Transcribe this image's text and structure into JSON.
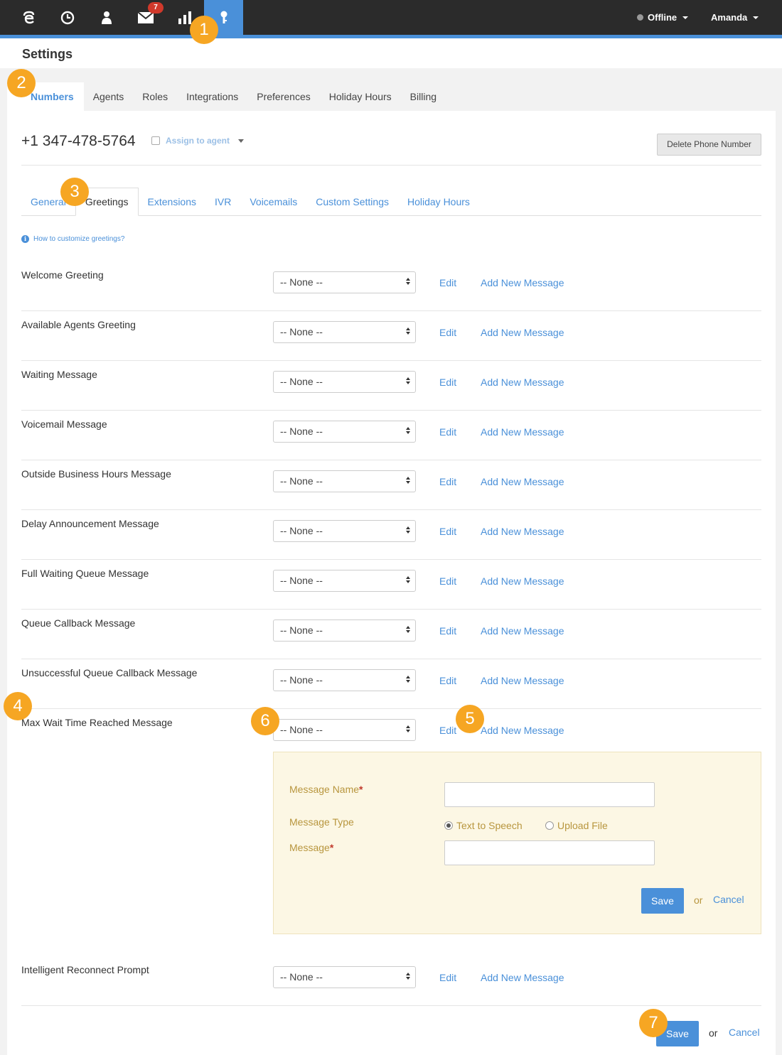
{
  "topnav": {
    "badge_count": "7",
    "status": "Offline",
    "user": "Amanda"
  },
  "page": {
    "title": "Settings"
  },
  "main_tabs": [
    "Numbers",
    "Agents",
    "Roles",
    "Integrations",
    "Preferences",
    "Holiday Hours",
    "Billing"
  ],
  "number": {
    "phone": "+1 347-478-5764",
    "assign_label": "Assign to agent",
    "delete_label": "Delete Phone Number"
  },
  "sub_tabs": [
    "General",
    "Greetings",
    "Extensions",
    "IVR",
    "Voicemails",
    "Custom Settings",
    "Holiday Hours"
  ],
  "help_text": "How to customize greetings?",
  "rows": [
    {
      "label": "Welcome Greeting",
      "value": "-- None --",
      "edit": "Edit",
      "add": "Add New Message"
    },
    {
      "label": "Available Agents Greeting",
      "value": "-- None --",
      "edit": "Edit",
      "add": "Add New Message"
    },
    {
      "label": "Waiting Message",
      "value": "-- None --",
      "edit": "Edit",
      "add": "Add New Message"
    },
    {
      "label": "Voicemail Message",
      "value": "-- None --",
      "edit": "Edit",
      "add": "Add New Message"
    },
    {
      "label": "Outside Business Hours Message",
      "value": "-- None --",
      "edit": "Edit",
      "add": "Add New Message"
    },
    {
      "label": "Delay Announcement Message",
      "value": "-- None --",
      "edit": "Edit",
      "add": "Add New Message"
    },
    {
      "label": "Full Waiting Queue Message",
      "value": "-- None --",
      "edit": "Edit",
      "add": "Add New Message"
    },
    {
      "label": "Queue Callback Message",
      "value": "-- None --",
      "edit": "Edit",
      "add": "Add New Message"
    },
    {
      "label": "Unsuccessful Queue Callback Message",
      "value": "-- None --",
      "edit": "Edit",
      "add": "Add New Message"
    },
    {
      "label": "Max Wait Time Reached Message",
      "value": "-- None --",
      "edit": "Edit",
      "add": "Add New Message"
    },
    {
      "label": "Intelligent Reconnect Prompt",
      "value": "-- None --",
      "edit": "Edit",
      "add": "Add New Message"
    }
  ],
  "form": {
    "name_label": "Message Name",
    "type_label": "Message Type",
    "message_label": "Message",
    "required_mark": "*",
    "option_tts": "Text to Speech",
    "option_upload": "Upload File",
    "save": "Save",
    "or": "or",
    "cancel": "Cancel"
  },
  "footer": {
    "save": "Save",
    "or": "or",
    "cancel": "Cancel"
  },
  "callouts": [
    "1",
    "2",
    "3",
    "4",
    "5",
    "6",
    "7"
  ],
  "colors": {
    "accent": "#4a90d9",
    "nav_bg": "#2b2b2b",
    "callout": "#f6a623",
    "form_bg": "#fcf7e4",
    "form_label": "#b8963e"
  }
}
